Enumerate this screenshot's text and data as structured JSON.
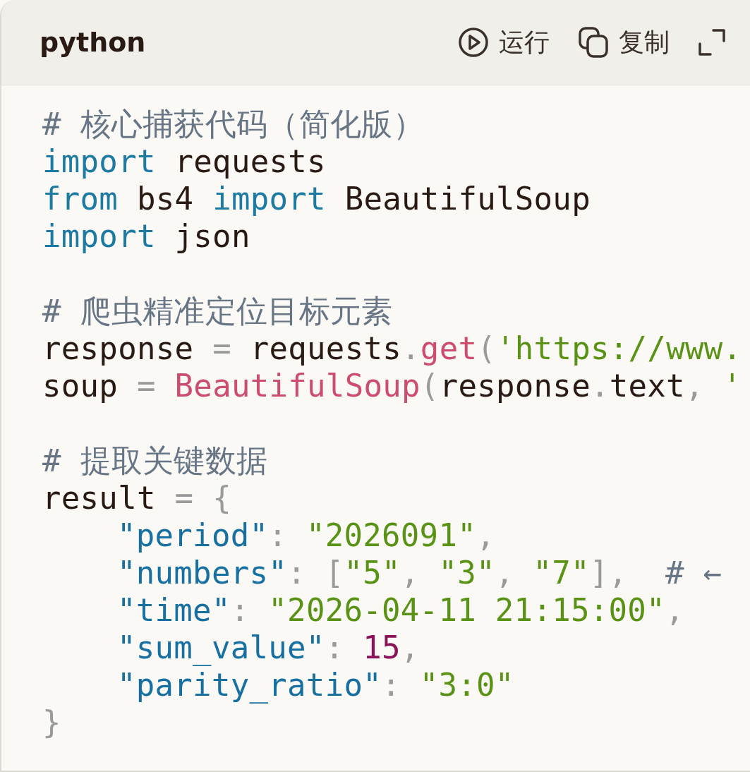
{
  "header": {
    "language": "python",
    "actions": [
      {
        "kind": "run",
        "label": "运行"
      },
      {
        "kind": "copy",
        "label": "复制"
      },
      {
        "kind": "expand"
      }
    ]
  },
  "code_lines": [
    {
      "kind": "code",
      "indented": false,
      "tokens": [
        {
          "kind": "comment",
          "text": "# 核心捕获代码（简化版）"
        }
      ]
    },
    {
      "kind": "code",
      "indented": false,
      "tokens": [
        {
          "kind": "keyword",
          "text": "import"
        },
        {
          "kind": "plain",
          "text": " requests"
        }
      ]
    },
    {
      "kind": "code",
      "indented": false,
      "tokens": [
        {
          "kind": "keyword",
          "text": "from"
        },
        {
          "kind": "plain",
          "text": " bs4 "
        },
        {
          "kind": "keyword",
          "text": "import"
        },
        {
          "kind": "plain",
          "text": " BeautifulSoup"
        }
      ]
    },
    {
      "kind": "code",
      "indented": false,
      "tokens": [
        {
          "kind": "keyword",
          "text": "import"
        },
        {
          "kind": "plain",
          "text": " json"
        }
      ]
    },
    {
      "kind": "blank"
    },
    {
      "kind": "code",
      "indented": false,
      "tokens": [
        {
          "kind": "comment",
          "text": "# 爬虫精准定位目标元素"
        }
      ]
    },
    {
      "kind": "code",
      "indented": false,
      "tokens": [
        {
          "kind": "plain",
          "text": "response "
        },
        {
          "kind": "punct",
          "text": "="
        },
        {
          "kind": "plain",
          "text": " requests"
        },
        {
          "kind": "punct",
          "text": "."
        },
        {
          "kind": "func",
          "text": "get"
        },
        {
          "kind": "punct",
          "text": "("
        },
        {
          "kind": "string",
          "text": "'https://www."
        }
      ]
    },
    {
      "kind": "code",
      "indented": false,
      "tokens": [
        {
          "kind": "plain",
          "text": "soup "
        },
        {
          "kind": "punct",
          "text": "= "
        },
        {
          "kind": "func",
          "text": "BeautifulSoup"
        },
        {
          "kind": "punct",
          "text": "("
        },
        {
          "kind": "plain",
          "text": "response"
        },
        {
          "kind": "punct",
          "text": "."
        },
        {
          "kind": "plain",
          "text": "text"
        },
        {
          "kind": "punct",
          "text": ", "
        },
        {
          "kind": "string",
          "text": "'"
        }
      ]
    },
    {
      "kind": "blank"
    },
    {
      "kind": "code",
      "indented": false,
      "tokens": [
        {
          "kind": "comment",
          "text": "# 提取关键数据"
        }
      ]
    },
    {
      "kind": "code",
      "indented": false,
      "tokens": [
        {
          "kind": "plain",
          "text": "result "
        },
        {
          "kind": "punct",
          "text": "= {"
        }
      ]
    },
    {
      "kind": "code",
      "indented": true,
      "tokens": [
        {
          "kind": "key",
          "text": "\"period\""
        },
        {
          "kind": "punct",
          "text": ": "
        },
        {
          "kind": "string",
          "text": "\"2026091\""
        },
        {
          "kind": "punct",
          "text": ","
        }
      ]
    },
    {
      "kind": "code",
      "indented": true,
      "tokens": [
        {
          "kind": "key",
          "text": "\"numbers\""
        },
        {
          "kind": "punct",
          "text": ": ["
        },
        {
          "kind": "string",
          "text": "\"5\""
        },
        {
          "kind": "punct",
          "text": ", "
        },
        {
          "kind": "string",
          "text": "\"3\""
        },
        {
          "kind": "punct",
          "text": ", "
        },
        {
          "kind": "string",
          "text": "\"7\""
        },
        {
          "kind": "punct",
          "text": "],  "
        },
        {
          "kind": "comment",
          "text": "# ←"
        }
      ]
    },
    {
      "kind": "code",
      "indented": true,
      "tokens": [
        {
          "kind": "key",
          "text": "\"time\""
        },
        {
          "kind": "punct",
          "text": ": "
        },
        {
          "kind": "string",
          "text": "\"2026-04-11 21:15:00\""
        },
        {
          "kind": "punct",
          "text": ","
        }
      ]
    },
    {
      "kind": "code",
      "indented": true,
      "tokens": [
        {
          "kind": "key",
          "text": "\"sum_value\""
        },
        {
          "kind": "punct",
          "text": ": "
        },
        {
          "kind": "number",
          "text": "15"
        },
        {
          "kind": "punct",
          "text": ","
        }
      ]
    },
    {
      "kind": "code",
      "indented": true,
      "tokens": [
        {
          "kind": "key",
          "text": "\"parity_ratio\""
        },
        {
          "kind": "punct",
          "text": ": "
        },
        {
          "kind": "string",
          "text": "\"3:0\""
        }
      ]
    },
    {
      "kind": "code",
      "indented": false,
      "tokens": [
        {
          "kind": "punct",
          "text": "}"
        }
      ]
    }
  ]
}
